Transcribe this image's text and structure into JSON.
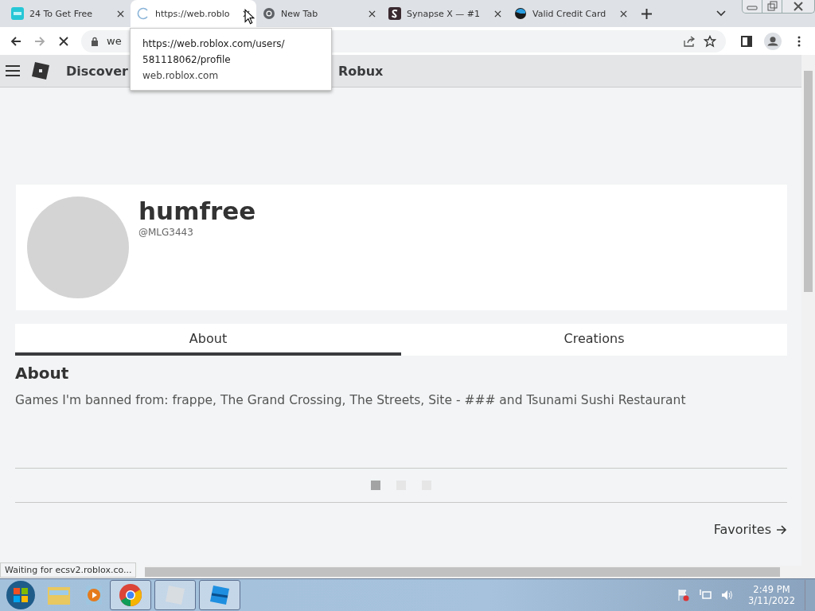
{
  "tabs": [
    {
      "title": "24 To Get Free",
      "selected": false
    },
    {
      "title": "https://web.roblo",
      "selected": true
    },
    {
      "title": "New Tab",
      "selected": false
    },
    {
      "title": "Synapse X — #1",
      "selected": false
    },
    {
      "title": "Valid Credit Card",
      "selected": false
    }
  ],
  "address": {
    "value": "we"
  },
  "tooltip": {
    "url_lines": [
      "https://web.roblox.com/users/",
      "581118062/profile"
    ],
    "host": "web.roblox.com"
  },
  "nav": {
    "items": [
      "Discover",
      "Robux"
    ]
  },
  "profile": {
    "display_name": "humfree",
    "username": "@MLG3443"
  },
  "profile_tabs": [
    {
      "label": "About",
      "selected": true
    },
    {
      "label": "Creations",
      "selected": false
    }
  ],
  "about": {
    "heading": "About",
    "text": "Games I'm banned from: frappe, The Grand Crossing, The Streets, Site - ### and Tsunami Sushi Restaurant"
  },
  "carousel": [
    {
      "selected": true
    },
    {
      "selected": false
    },
    {
      "selected": false
    }
  ],
  "favorites": {
    "label": "Favorites"
  },
  "status": "Waiting for ecsv2.roblox.co...",
  "clock": {
    "time": "2:49 PM",
    "date": "3/11/2022"
  }
}
